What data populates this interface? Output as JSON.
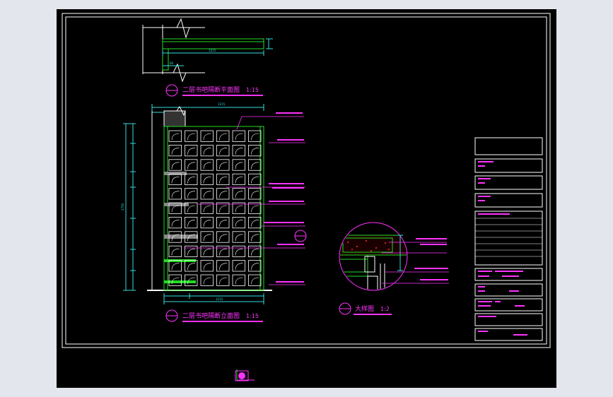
{
  "drawing": {
    "plan": {
      "title": "二层书吧隔断平面图",
      "scale": "1:15",
      "dim_width": "1215",
      "dim_small": "60"
    },
    "elevation": {
      "title": "二层书吧隔断立面图",
      "scale": "1:15",
      "dim_top": "1215",
      "dim_bottom": "1215",
      "dim_total_height": "2750"
    },
    "detail": {
      "title": "大样图",
      "scale": "1:2"
    }
  },
  "colors": {
    "frame": "#ffffff",
    "line_green": "#22dd22",
    "line_cyan": "#33dddd",
    "label_magenta": "#ff33ff"
  }
}
